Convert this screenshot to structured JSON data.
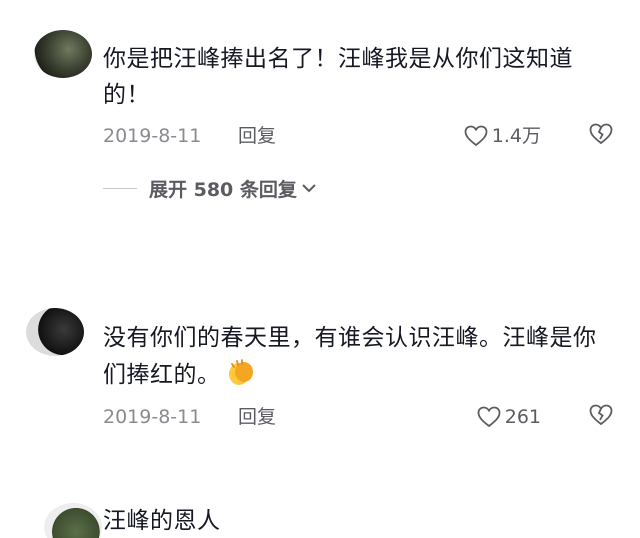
{
  "comments": [
    {
      "text": "你是把汪峰捧出名了！汪峰我是从你们这知道的！",
      "date": "2019-8-11",
      "reply_label": "回复",
      "likes": "1.4万",
      "expand_label": "展开 580 条回复"
    },
    {
      "text": "没有你们的春天里，有谁会认识汪峰。汪峰是你们捧红的。",
      "date": "2019-8-11",
      "reply_label": "回复",
      "likes": "261"
    },
    {
      "text": "汪峰的恩人"
    }
  ],
  "colors": {
    "text": "#161823",
    "meta": "#8a8b91",
    "icon": "#5b5c61"
  },
  "icons": [
    "heart-outline-icon",
    "broken-heart-icon",
    "chevron-down-icon",
    "clapping-hands-emoji"
  ]
}
